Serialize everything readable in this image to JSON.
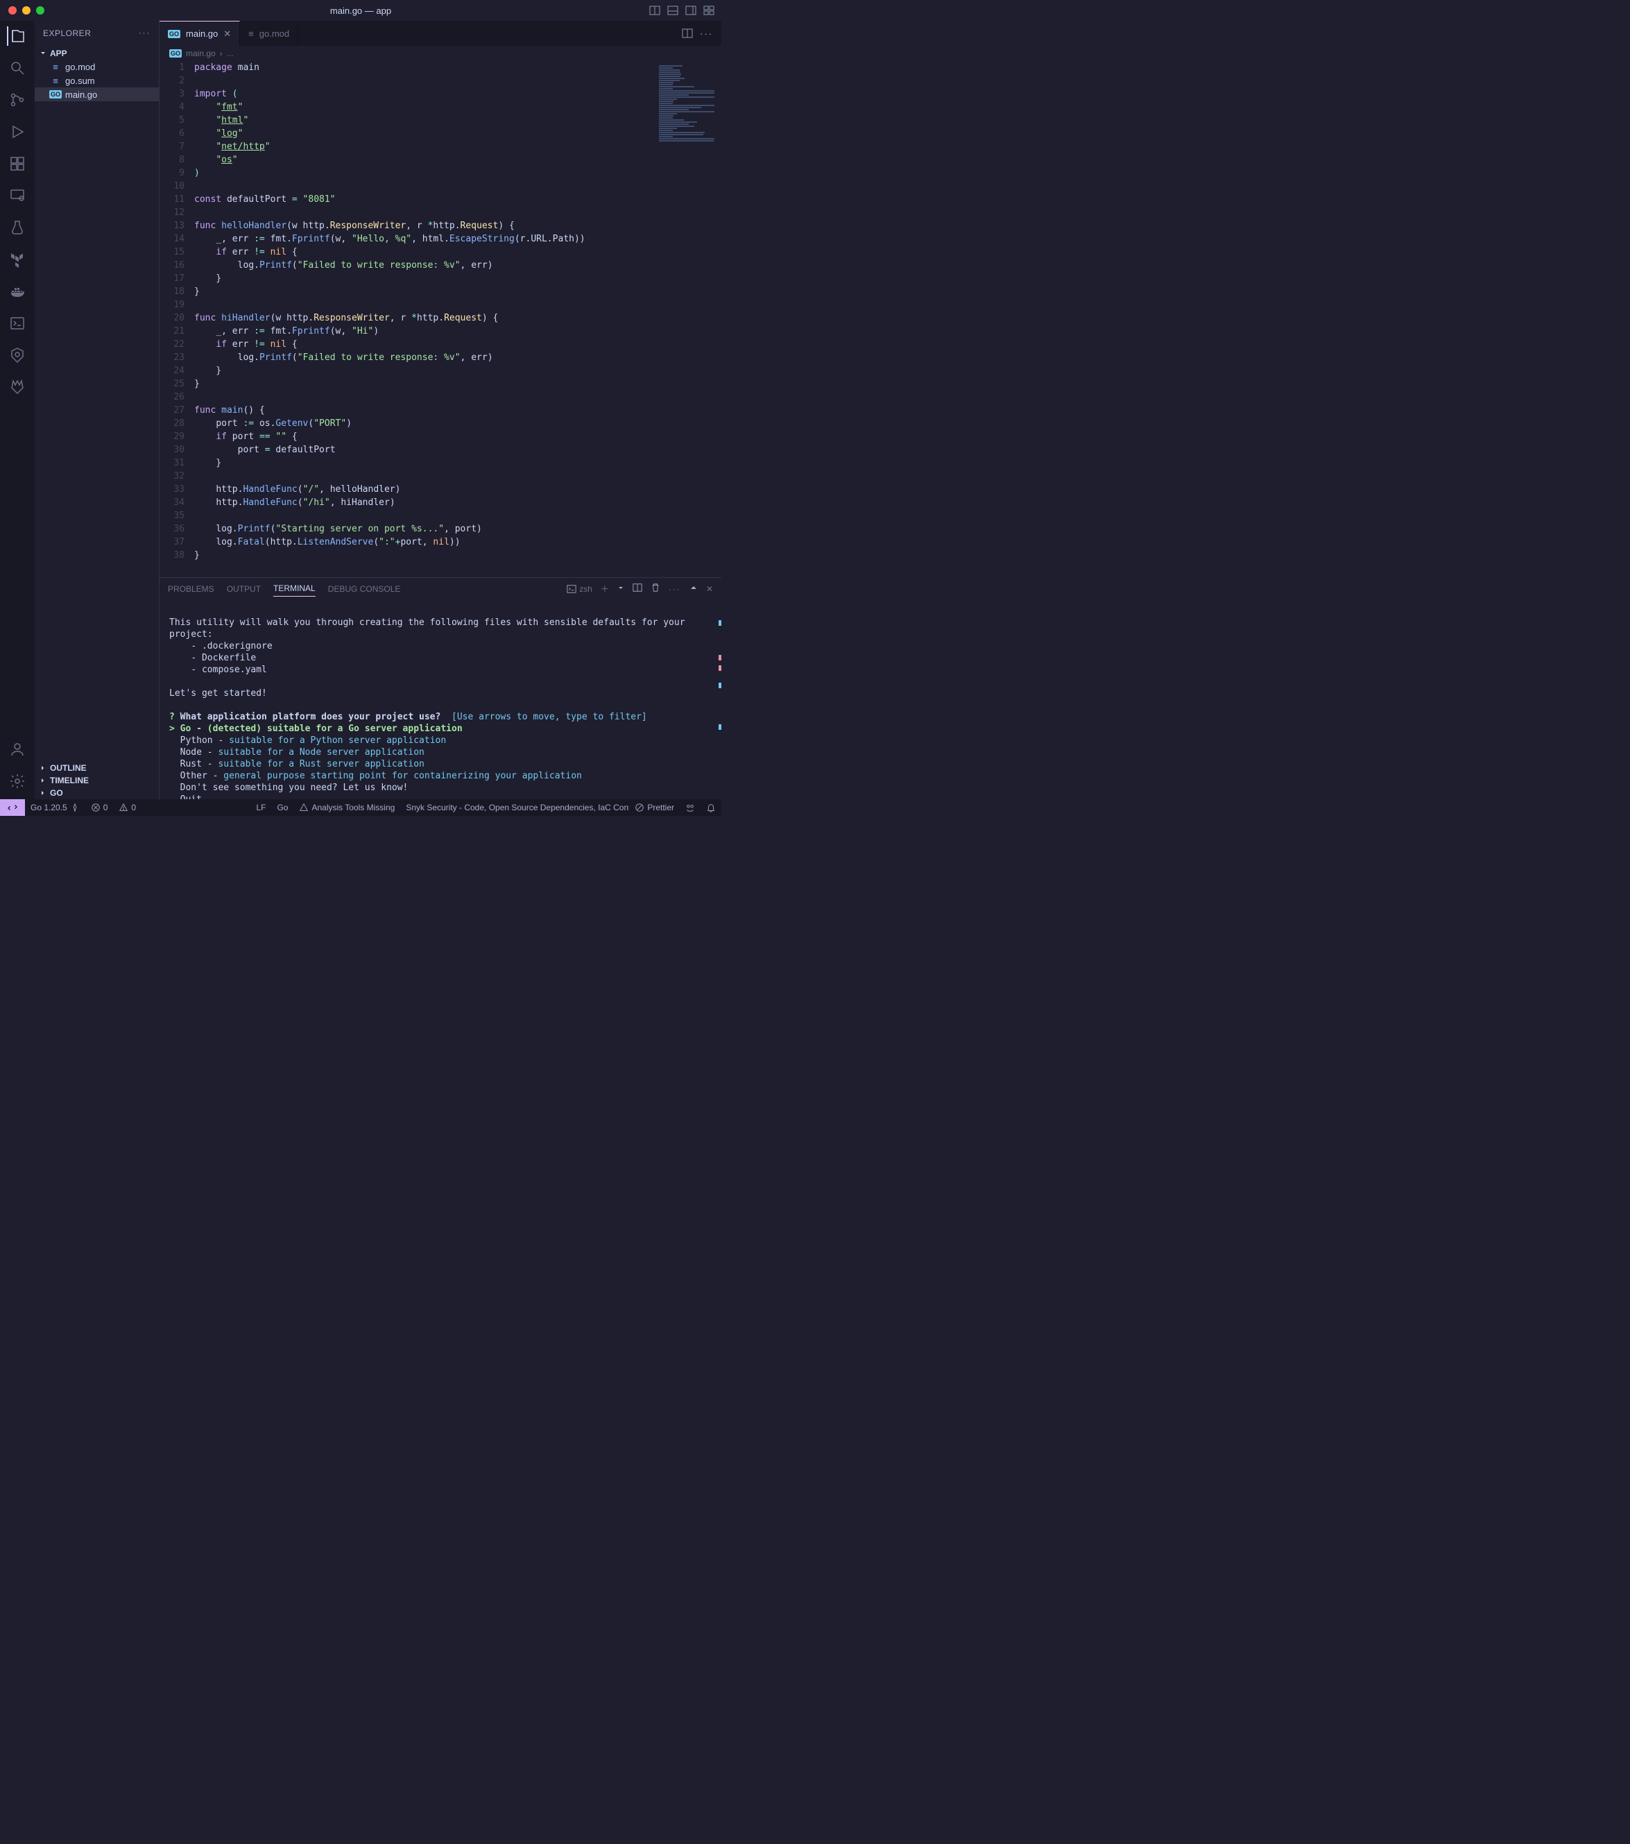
{
  "window_title": "main.go — app",
  "explorer_label": "EXPLORER",
  "app_folder": "APP",
  "files": {
    "gomod": "go.mod",
    "gosum": "go.sum",
    "maingo": "main.go"
  },
  "outline_label": "OUTLINE",
  "timeline_label": "TIMELINE",
  "go_label": "GO",
  "tabs": {
    "main": "main.go",
    "gomod": "go.mod"
  },
  "breadcrumb": {
    "file": "main.go",
    "more": "..."
  },
  "code_lines": [
    {
      "n": 1,
      "html": "<span class='kw'>package</span> <span class='pkg'>main</span>"
    },
    {
      "n": 2,
      "html": ""
    },
    {
      "n": 3,
      "html": "<span class='kw'>import</span> <span class='op'>(</span>"
    },
    {
      "n": 4,
      "html": "    <span class='str'>\"<span class='ul'>fmt</span>\"</span>"
    },
    {
      "n": 5,
      "html": "    <span class='str'>\"<span class='ul'>html</span>\"</span>"
    },
    {
      "n": 6,
      "html": "    <span class='str'>\"<span class='ul'>log</span>\"</span>"
    },
    {
      "n": 7,
      "html": "    <span class='str'>\"<span class='ul'>net/http</span>\"</span>"
    },
    {
      "n": 8,
      "html": "    <span class='str'>\"<span class='ul'>os</span>\"</span>"
    },
    {
      "n": 9,
      "html": "<span class='op'>)</span>"
    },
    {
      "n": 10,
      "html": ""
    },
    {
      "n": 11,
      "html": "<span class='kw'>const</span> <span class='id'>defaultPort</span> <span class='op'>=</span> <span class='str'>\"8081\"</span>"
    },
    {
      "n": 12,
      "html": ""
    },
    {
      "n": 13,
      "html": "<span class='kw'>func</span> <span class='fn'>helloHandler</span>(<span class='id'>w</span> <span class='id'>http</span>.<span class='ty'>ResponseWriter</span>, <span class='id'>r</span> <span class='op'>*</span><span class='id'>http</span>.<span class='ty'>Request</span>) {"
    },
    {
      "n": 14,
      "html": "    <span class='id'>_</span>, <span class='id'>err</span> <span class='op'>:=</span> <span class='id'>fmt</span>.<span class='fn'>Fprintf</span>(<span class='id'>w</span>, <span class='str'>\"Hello, %q\"</span>, <span class='id'>html</span>.<span class='fn'>EscapeString</span>(<span class='id'>r</span>.<span class='id'>URL</span>.<span class='id'>Path</span>))"
    },
    {
      "n": 15,
      "html": "    <span class='kw'>if</span> <span class='id'>err</span> <span class='op'>!=</span> <span class='cn'>nil</span> {"
    },
    {
      "n": 16,
      "html": "        <span class='id'>log</span>.<span class='fn'>Printf</span>(<span class='str'>\"Failed to write response: %v\"</span>, <span class='id'>err</span>)"
    },
    {
      "n": 17,
      "html": "    }"
    },
    {
      "n": 18,
      "html": "}"
    },
    {
      "n": 19,
      "html": ""
    },
    {
      "n": 20,
      "html": "<span class='kw'>func</span> <span class='fn'>hiHandler</span>(<span class='id'>w</span> <span class='id'>http</span>.<span class='ty'>ResponseWriter</span>, <span class='id'>r</span> <span class='op'>*</span><span class='id'>http</span>.<span class='ty'>Request</span>) {"
    },
    {
      "n": 21,
      "html": "    <span class='id'>_</span>, <span class='id'>err</span> <span class='op'>:=</span> <span class='id'>fmt</span>.<span class='fn'>Fprintf</span>(<span class='id'>w</span>, <span class='str'>\"Hi\"</span>)"
    },
    {
      "n": 22,
      "html": "    <span class='kw'>if</span> <span class='id'>err</span> <span class='op'>!=</span> <span class='cn'>nil</span> {"
    },
    {
      "n": 23,
      "html": "        <span class='id'>log</span>.<span class='fn'>Printf</span>(<span class='str'>\"Failed to write response: %v\"</span>, <span class='id'>err</span>)"
    },
    {
      "n": 24,
      "html": "    }"
    },
    {
      "n": 25,
      "html": "}"
    },
    {
      "n": 26,
      "html": ""
    },
    {
      "n": 27,
      "html": "<span class='kw'>func</span> <span class='fn'>main</span>() {"
    },
    {
      "n": 28,
      "html": "    <span class='id'>port</span> <span class='op'>:=</span> <span class='id'>os</span>.<span class='fn'>Getenv</span>(<span class='str'>\"PORT\"</span>)"
    },
    {
      "n": 29,
      "html": "    <span class='kw'>if</span> <span class='id'>port</span> <span class='op'>==</span> <span class='str'>\"\"</span> {"
    },
    {
      "n": 30,
      "html": "        <span class='id'>port</span> <span class='op'>=</span> <span class='id'>defaultPort</span>"
    },
    {
      "n": 31,
      "html": "    }"
    },
    {
      "n": 32,
      "html": ""
    },
    {
      "n": 33,
      "html": "    <span class='id'>http</span>.<span class='fn'>HandleFunc</span>(<span class='str'>\"/\"</span>, <span class='id'>helloHandler</span>)"
    },
    {
      "n": 34,
      "html": "    <span class='id'>http</span>.<span class='fn'>HandleFunc</span>(<span class='str'>\"/hi\"</span>, <span class='id'>hiHandler</span>)"
    },
    {
      "n": 35,
      "html": ""
    },
    {
      "n": 36,
      "html": "    <span class='id'>log</span>.<span class='fn'>Printf</span>(<span class='str'>\"Starting server on port %s...\"</span>, <span class='id'>port</span>)"
    },
    {
      "n": 37,
      "html": "    <span class='id'>log</span>.<span class='fn'>Fatal</span>(<span class='id'>http</span>.<span class='fn'>ListenAndServe</span>(<span class='str'>\":\"</span><span class='op'>+</span><span class='id'>port</span>, <span class='cn'>nil</span>))"
    },
    {
      "n": 38,
      "html": "}"
    }
  ],
  "panel_tabs": {
    "problems": "PROBLEMS",
    "output": "OUTPUT",
    "terminal": "TERMINAL",
    "debug": "DEBUG CONSOLE"
  },
  "terminal_shell": "zsh",
  "terminal": {
    "intro": "This utility will walk you through creating the following files with sensible defaults for your project:",
    "f1": "    - .dockerignore",
    "f2": "    - Dockerfile",
    "f3": "    - compose.yaml",
    "start": "Let's get started!",
    "q_mark": "?",
    "q": " What application platform does your project use?",
    "hint": "  [Use arrows to move, type to filter]",
    "sel_mark": ">",
    "sel": " Go - (detected) suitable for a Go server application",
    "o1a": "  Python - ",
    "o1b": "suitable for a Python server application",
    "o2a": "  Node - ",
    "o2b": "suitable for a Node server application",
    "o3a": "  Rust - ",
    "o3b": "suitable for a Rust server application",
    "o4a": "  Other - ",
    "o4b": "general purpose starting point for containerizing your application",
    "o5": "  Don't see something you need? Let us know!",
    "o6": "  Quit"
  },
  "status": {
    "go_version": "Go 1.20.5",
    "errors": "0",
    "warnings": "0",
    "eol": "LF",
    "lang": "Go",
    "analysis": "Analysis Tools Missing",
    "snyk": "Snyk Security - Code, Open Source Dependencies, IaC Configuratic",
    "prettier": "Prettier"
  }
}
